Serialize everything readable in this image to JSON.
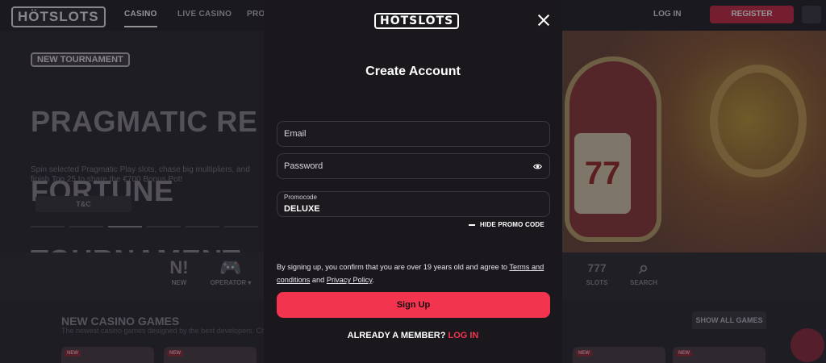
{
  "site": {
    "logo": "HÖTSLOTS",
    "nav": [
      "CASINO",
      "LIVE CASINO",
      "PRO"
    ],
    "login": "LOG IN",
    "register": "REGISTER",
    "hero": {
      "badge": "NEW TOURNAMENT",
      "title_line1": "PRAGMATIC RE",
      "title_line2": "FORTUNE",
      "title_line3": "TOURNAMENT",
      "description": "Spin selected Pragmatic Play slots, chase big multipliers, and finish Top 25 to share the €700 Bonus Pot!",
      "tc_button": "T&C",
      "slot_symbol": "77"
    },
    "categories": [
      {
        "icon": "N!",
        "label": "NEW"
      },
      {
        "icon": "🎮",
        "label": "OPERATOR ▾"
      },
      {
        "icon": "777",
        "label": "SLOTS"
      },
      {
        "icon": "⌕",
        "label": "SEARCH"
      }
    ],
    "section_title": "NEW CASINO GAMES",
    "section_sub": "The newest casino games designed by the best developers. Che",
    "show_all": "SHOW ALL GAMES",
    "new_tag": "NEW"
  },
  "modal": {
    "logo": "HÖTSLOTS",
    "title": "Create Account",
    "email_placeholder": "Email",
    "password_placeholder": "Password",
    "promo_label": "Promocode",
    "promo_value": "DELUXE",
    "hide_promo": "HIDE PROMO CODE",
    "terms_prefix": "By signing up, you confirm that you are over 19 years old and agree to ",
    "terms_link": "Terms and conditions",
    "terms_and": " and ",
    "privacy_link": "Privacy Policy",
    "terms_suffix": ".",
    "signup_button": "Sign Up",
    "already_member": "ALREADY A MEMBER?",
    "login_link": "LOG IN"
  },
  "colors": {
    "accent": "#f2344f",
    "modal_bg": "#1a181c"
  }
}
